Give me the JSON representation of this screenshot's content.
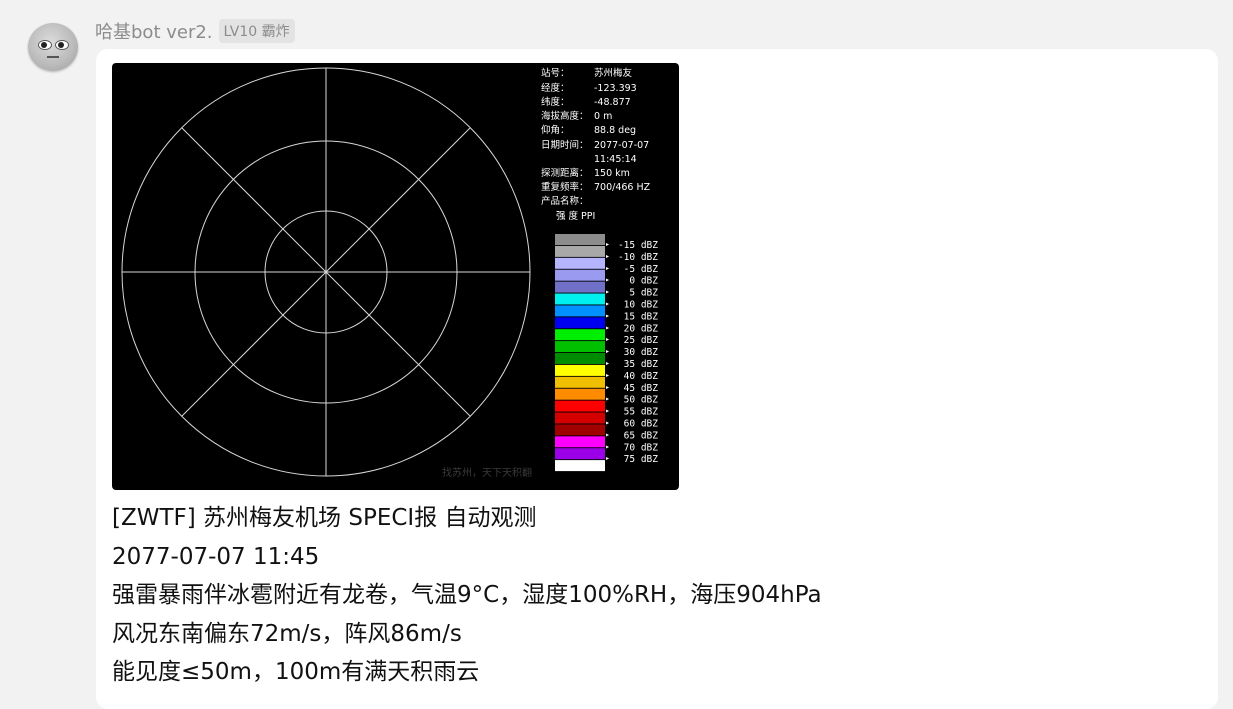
{
  "header": {
    "username": "哈基bot ver2.",
    "level_badge": "LV10 霸炸"
  },
  "radar": {
    "station_label": "站号：",
    "station_value": "苏州梅友",
    "longitude_label": "经度：",
    "longitude_value": "-123.393",
    "latitude_label": "纬度：",
    "latitude_value": "-48.877",
    "altitude_label": "海拔高度：",
    "altitude_value": "0 m",
    "elevation_label": "仰角：",
    "elevation_value": "88.8  deg",
    "datetime_label": "日期时间：",
    "date_value": "2077-07-07",
    "time_value": "11:45:14",
    "range_label": "探测距离：",
    "range_value": "150 km",
    "prf_label": "重复频率：",
    "prf_value": "700/466 HZ",
    "product_label": "产品名称：",
    "product_value": "强 度 PPI",
    "watermark": "找苏州，天下天积翻",
    "scale": [
      {
        "label": "-15 dBZ",
        "color": "#8c8c8c"
      },
      {
        "label": "-10 dBZ",
        "color": "#a8a8a8"
      },
      {
        "label": "-5 dBZ",
        "color": "#b4b4ff"
      },
      {
        "label": "0 dBZ",
        "color": "#9a9af0"
      },
      {
        "label": "5 dBZ",
        "color": "#7070c8"
      },
      {
        "label": "10 dBZ",
        "color": "#00f0f0"
      },
      {
        "label": "15 dBZ",
        "color": "#0090ff"
      },
      {
        "label": "20 dBZ",
        "color": "#0000f0"
      },
      {
        "label": "25 dBZ",
        "color": "#00ee00"
      },
      {
        "label": "30 dBZ",
        "color": "#00c000"
      },
      {
        "label": "35 dBZ",
        "color": "#008c00"
      },
      {
        "label": "40 dBZ",
        "color": "#ffff00"
      },
      {
        "label": "45 dBZ",
        "color": "#f0c000"
      },
      {
        "label": "50 dBZ",
        "color": "#ff8c00"
      },
      {
        "label": "55 dBZ",
        "color": "#ff0000"
      },
      {
        "label": "60 dBZ",
        "color": "#d40000"
      },
      {
        "label": "65 dBZ",
        "color": "#a00000"
      },
      {
        "label": "70 dBZ",
        "color": "#ff00ff"
      },
      {
        "label": "75 dBZ",
        "color": "#9c00e8"
      },
      {
        "label": "",
        "color": "#ffffff"
      }
    ]
  },
  "message": {
    "line1": "[ZWTF] 苏州梅友机场 SPECI报 自动观测",
    "line2": "2077-07-07 11:45",
    "line3": "强雷暴雨伴冰雹附近有龙卷，气温9°C，湿度100%RH，海压904hPa",
    "line4": "风况东南偏东72m/s，阵风86m/s",
    "line5": "能见度≤50m，100m有满天积雨云"
  }
}
